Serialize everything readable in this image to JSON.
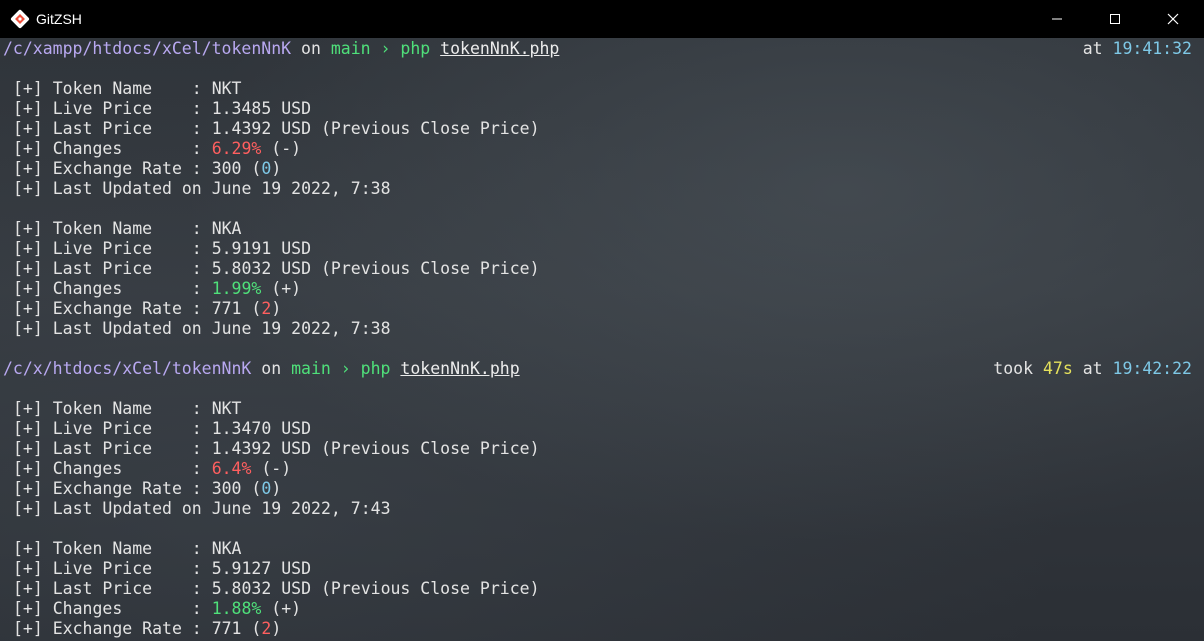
{
  "window": {
    "title": "GitZSH",
    "icons": {
      "logo": "git-logo-icon",
      "minimize": "minimize-icon",
      "maximize": "maximize-icon",
      "close": "close-icon"
    }
  },
  "colors": {
    "path": "#b8a8f0",
    "branch": "#4fe07a",
    "time": "#7ec8e6",
    "duration": "#e4e05c",
    "negative": "#ff5f5f",
    "positive": "#4fe07a",
    "text": "#e3e3e3"
  },
  "prompts": [
    {
      "path": "/c/xampp/htdocs/xCel/tokenNnK",
      "on": "on",
      "branch": "main",
      "arrow": "›",
      "cmd": "php",
      "file": "tokenNnK.php",
      "took": "",
      "duration": "",
      "at": "at",
      "time": "19:41:32"
    },
    {
      "path": "/c/x/htdocs/xCel/tokenNnK",
      "on": "on",
      "branch": "main",
      "arrow": "›",
      "cmd": "php",
      "file": "tokenNnK.php",
      "took": "took",
      "duration": "47s",
      "at": "at",
      "time": "19:42:22"
    }
  ],
  "outputs": [
    [
      {
        "labels": {
          "name": "[+] Token Name    : ",
          "live": "[+] Live Price    : ",
          "last": "[+] Last Price    : ",
          "changes": "[+] Changes       : ",
          "rate": "[+] Exchange Rate : ",
          "updated": "[+] Last Updated on "
        },
        "name": "NKT",
        "live": "1.3485 USD",
        "last": "1.4392 USD (Previous Close Price)",
        "change_pct": "6.29%",
        "change_sign": " (-)",
        "rate": "300",
        "rate_delta": "0",
        "updated": "June 19 2022, 7:38"
      },
      {
        "labels": {
          "name": "[+] Token Name    : ",
          "live": "[+] Live Price    : ",
          "last": "[+] Last Price    : ",
          "changes": "[+] Changes       : ",
          "rate": "[+] Exchange Rate : ",
          "updated": "[+] Last Updated on "
        },
        "name": "NKA",
        "live": "5.9191 USD",
        "last": "5.8032 USD (Previous Close Price)",
        "change_pct": "1.99%",
        "change_sign": " (+)",
        "rate": "771",
        "rate_delta": "2",
        "updated": "June 19 2022, 7:38"
      }
    ],
    [
      {
        "labels": {
          "name": "[+] Token Name    : ",
          "live": "[+] Live Price    : ",
          "last": "[+] Last Price    : ",
          "changes": "[+] Changes       : ",
          "rate": "[+] Exchange Rate : ",
          "updated": "[+] Last Updated on "
        },
        "name": "NKT",
        "live": "1.3470 USD",
        "last": "1.4392 USD (Previous Close Price)",
        "change_pct": "6.4%",
        "change_sign": " (-)",
        "rate": "300",
        "rate_delta": "0",
        "updated": "June 19 2022, 7:43"
      },
      {
        "labels": {
          "name": "[+] Token Name    : ",
          "live": "[+] Live Price    : ",
          "last": "[+] Last Price    : ",
          "changes": "[+] Changes       : ",
          "rate": "[+] Exchange Rate : ",
          "updated": "[+] Last Updated on "
        },
        "name": "NKA",
        "live": "5.9127 USD",
        "last": "5.8032 USD (Previous Close Price)",
        "change_pct": "1.88%",
        "change_sign": " (+)",
        "rate": "771",
        "rate_delta": "2",
        "updated": ""
      }
    ]
  ]
}
